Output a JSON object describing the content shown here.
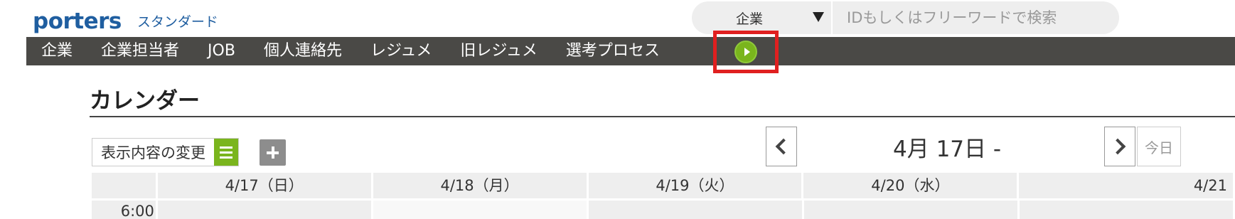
{
  "brand": {
    "logo_text": "porters",
    "edition": "スタンダード",
    "colors": {
      "brand_blue": "#1f5ea0",
      "accent_green": "#7ab51d",
      "nav_bg": "#4a4946",
      "highlight_red": "#e02020"
    }
  },
  "search": {
    "scope": "企業",
    "placeholder": "IDもしくはフリーワードで検索"
  },
  "nav": {
    "items": [
      "企業",
      "企業担当者",
      "JOB",
      "個人連絡先",
      "レジュメ",
      "旧レジュメ",
      "選考プロセス"
    ],
    "more_icon": "play-circle-icon"
  },
  "page": {
    "title": "カレンダー"
  },
  "toolbar": {
    "display_change_label": "表示内容の変更",
    "list_icon": "list-icon",
    "add_icon": "plus-icon"
  },
  "calendar": {
    "range_label": "4月 17日 -",
    "today_label": "今日",
    "days": [
      "4/17（日）",
      "4/18（月）",
      "4/19（火）",
      "4/20（水）",
      "4/21"
    ],
    "time_rows": [
      "6:00"
    ]
  }
}
